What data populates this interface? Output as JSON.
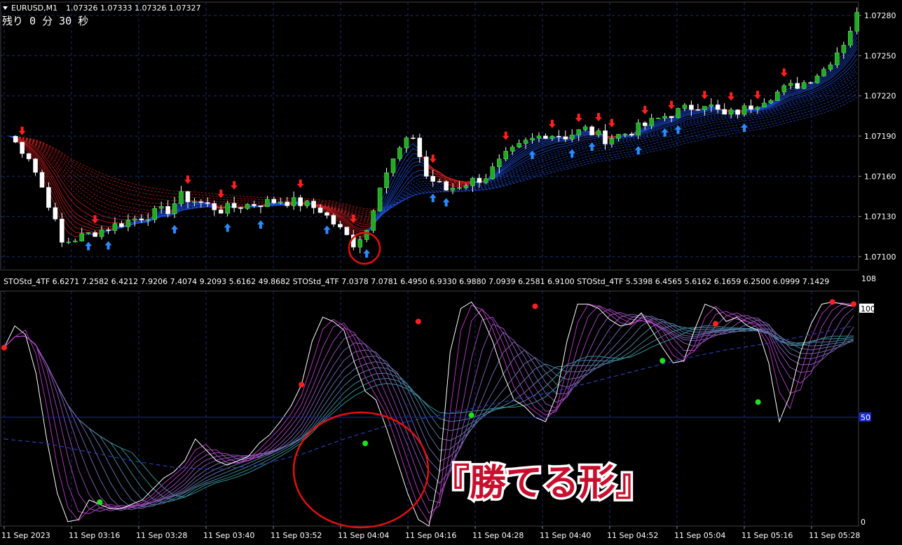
{
  "header": {
    "symbol": "EURUSD,M1",
    "quotes": "1.07326 1.07333 1.07326 1.07327",
    "timer": "残り 0 分 30 秒"
  },
  "indicator_header": {
    "text": "STOStd_4TF 6.6271 7.2582 6.4212 7.9206 7.4074 9.2093 5.6162 49.8682  STOStd_4TF 7.0378 7.0781 6.4950 6.9330 6.9880 7.0939 6.2581 6.9100  STOStd_4TF 5.5398 6.4565 5.6162 6.1659 6.2500 6.0999 7.1429"
  },
  "caption": "『勝てる形』",
  "colors": {
    "background": "#000000",
    "grid": "#1c2a6e",
    "bull_candle": "#22aa22",
    "bear_candle": "#ffffff",
    "down_arrow": "#ff2020",
    "up_arrow": "#2a8cff",
    "ribbon_red": "#d02020",
    "ribbon_blue": "#2050e0",
    "stoch_fast": "#ffffff",
    "stoch_magenta": "#d030d0",
    "stoch_teal": "#30a0a0",
    "highlight_circle": "#e01010",
    "level_line": "#2020c0"
  },
  "chart_data": [
    {
      "type": "candlestick",
      "title": "EURUSD,M1",
      "ylim": [
        1.0709,
        1.0729
      ],
      "y_ticks": [
        "1.07280",
        "1.07250",
        "1.07220",
        "1.07190",
        "1.07160",
        "1.07130",
        "1.07100"
      ],
      "price_path": [
        [
          0,
          1.0719
        ],
        [
          3,
          1.07175
        ],
        [
          6,
          1.0714
        ],
        [
          8,
          1.0711
        ],
        [
          11,
          1.07115
        ],
        [
          14,
          1.0712
        ],
        [
          17,
          1.07125
        ],
        [
          20,
          1.0713
        ],
        [
          24,
          1.07135
        ],
        [
          26,
          1.07145
        ],
        [
          29,
          1.0714
        ],
        [
          32,
          1.07135
        ],
        [
          35,
          1.07138
        ],
        [
          38,
          1.0714
        ],
        [
          41,
          1.07142
        ],
        [
          44,
          1.0714
        ],
        [
          47,
          1.07135
        ],
        [
          50,
          1.0712
        ],
        [
          52,
          1.0711
        ],
        [
          54,
          1.0712
        ],
        [
          56,
          1.07155
        ],
        [
          59,
          1.0718
        ],
        [
          61,
          1.0719
        ],
        [
          63,
          1.0716
        ],
        [
          66,
          1.0715
        ],
        [
          69,
          1.07155
        ],
        [
          72,
          1.0716
        ],
        [
          75,
          1.07175
        ],
        [
          78,
          1.07185
        ],
        [
          81,
          1.07192
        ],
        [
          84,
          1.0719
        ],
        [
          87,
          1.07195
        ],
        [
          90,
          1.07188
        ],
        [
          93,
          1.07192
        ],
        [
          96,
          1.07198
        ],
        [
          99,
          1.07205
        ],
        [
          102,
          1.0721
        ],
        [
          105,
          1.07215
        ],
        [
          108,
          1.07205
        ],
        [
          111,
          1.0721
        ],
        [
          114,
          1.07218
        ],
        [
          117,
          1.07225
        ],
        [
          120,
          1.0723
        ],
        [
          123,
          1.0724
        ],
        [
          126,
          1.0726
        ],
        [
          128,
          1.0728
        ]
      ],
      "signals": {
        "sell_bars": [
          2,
          13,
          27,
          32,
          34,
          44,
          52,
          64,
          75,
          82,
          86,
          89,
          91,
          96,
          100,
          105,
          109,
          113,
          117
        ],
        "buy_bars": [
          12,
          15,
          25,
          33,
          38,
          48,
          54,
          64,
          66,
          79,
          85,
          88,
          95,
          99,
          101,
          111
        ]
      }
    },
    {
      "type": "line",
      "title": "STOStd_4TF",
      "ylim": [
        0,
        108
      ],
      "y_ticks": [
        "108",
        "100",
        "50",
        "0"
      ],
      "x_ticks": [
        "11 Sep 2023",
        "11 Sep 03:16",
        "11 Sep 03:28",
        "11 Sep 03:40",
        "11 Sep 03:52",
        "11 Sep 04:04",
        "11 Sep 04:16",
        "11 Sep 04:28",
        "11 Sep 04:40",
        "11 Sep 04:52",
        "11 Sep 05:04",
        "11 Sep 05:16",
        "11 Sep 05:28"
      ],
      "series": [
        {
          "values": [
            [
              0,
              82
            ],
            [
              1,
              92
            ],
            [
              2,
              88
            ],
            [
              3,
              70
            ],
            [
              4,
              40
            ],
            [
              5,
              15
            ],
            [
              6,
              2
            ],
            [
              7,
              3
            ],
            [
              8,
              12
            ],
            [
              9,
              10
            ],
            [
              10,
              8
            ],
            [
              11,
              8
            ],
            [
              12,
              10
            ],
            [
              13,
              12
            ],
            [
              14,
              17
            ],
            [
              15,
              22
            ],
            [
              16,
              25
            ],
            [
              17,
              30
            ],
            [
              18,
              40
            ],
            [
              19,
              35
            ],
            [
              20,
              30
            ],
            [
              21,
              28
            ],
            [
              22,
              30
            ],
            [
              23,
              32
            ],
            [
              24,
              38
            ],
            [
              25,
              42
            ],
            [
              26,
              48
            ],
            [
              27,
              55
            ],
            [
              28,
              65
            ],
            [
              29,
              85
            ],
            [
              30,
              96
            ],
            [
              31,
              94
            ],
            [
              32,
              90
            ],
            [
              33,
              75
            ],
            [
              34,
              62
            ],
            [
              35,
              58
            ],
            [
              36,
              45
            ],
            [
              37,
              30
            ],
            [
              38,
              15
            ],
            [
              39,
              3
            ],
            [
              40,
              0
            ],
            [
              41,
              25
            ],
            [
              42,
              80
            ],
            [
              43,
              100
            ],
            [
              44,
              103
            ],
            [
              45,
              96
            ],
            [
              46,
              85
            ],
            [
              47,
              70
            ],
            [
              48,
              58
            ],
            [
              49,
              55
            ],
            [
              50,
              50
            ],
            [
              51,
              48
            ],
            [
              52,
              60
            ],
            [
              53,
              85
            ],
            [
              54,
              102
            ],
            [
              55,
              102
            ],
            [
              56,
              100
            ],
            [
              57,
              95
            ],
            [
              58,
              92
            ],
            [
              59,
              93
            ],
            [
              60,
              98
            ],
            [
              61,
              90
            ],
            [
              62,
              82
            ],
            [
              63,
              75
            ],
            [
              64,
              76
            ],
            [
              65,
              90
            ],
            [
              66,
              102
            ],
            [
              67,
              100
            ],
            [
              68,
              94
            ],
            [
              69,
              96
            ],
            [
              70,
              92
            ],
            [
              71,
              90
            ],
            [
              72,
              75
            ],
            [
              73,
              48
            ],
            [
              74,
              60
            ],
            [
              75,
              80
            ],
            [
              76,
              93
            ],
            [
              77,
              102
            ],
            [
              78,
              103
            ],
            [
              79,
              102
            ],
            [
              80,
              101
            ]
          ]
        },
        {
          "values": [
            [
              0,
              40
            ],
            [
              4,
              38
            ],
            [
              8,
              34
            ],
            [
              12,
              30
            ],
            [
              16,
              27
            ],
            [
              20,
              26
            ],
            [
              24,
              28
            ],
            [
              28,
              33
            ],
            [
              32,
              40
            ],
            [
              36,
              46
            ],
            [
              40,
              50
            ],
            [
              44,
              54
            ],
            [
              48,
              58
            ],
            [
              52,
              62
            ],
            [
              56,
              67
            ],
            [
              60,
              72
            ],
            [
              64,
              77
            ],
            [
              68,
              81
            ],
            [
              72,
              84
            ],
            [
              76,
              88
            ],
            [
              80,
              92
            ]
          ]
        }
      ],
      "signal_dots": {
        "red": [
          [
            0,
            82
          ],
          [
            28,
            65
          ],
          [
            39,
            94
          ],
          [
            50,
            101
          ],
          [
            67,
            93
          ],
          [
            78,
            103
          ],
          [
            80,
            102
          ]
        ],
        "green": [
          [
            9,
            11
          ],
          [
            34,
            38
          ],
          [
            44,
            51
          ],
          [
            62,
            76
          ],
          [
            71,
            57
          ]
        ]
      }
    }
  ]
}
